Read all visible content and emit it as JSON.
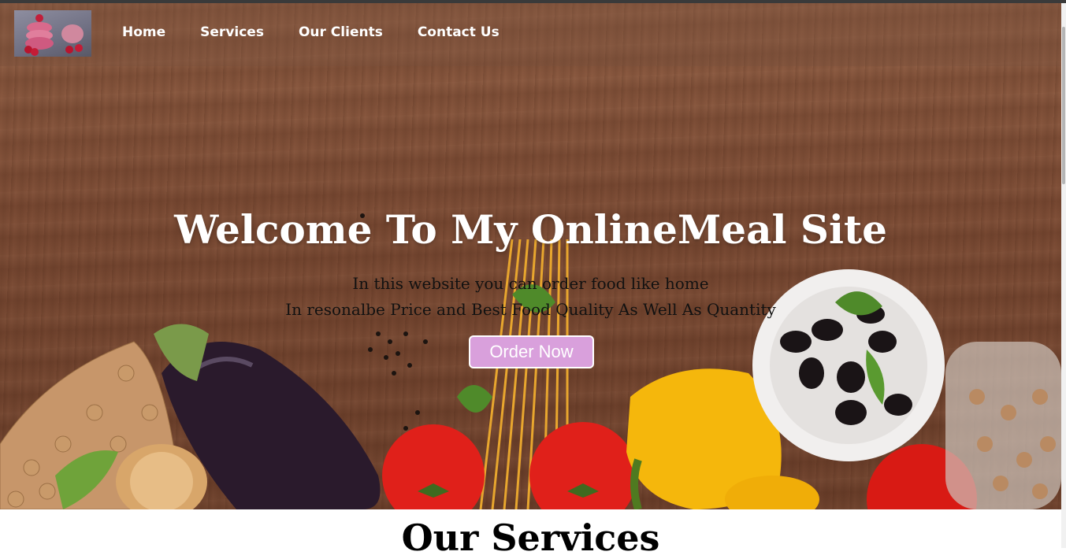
{
  "nav": {
    "logo_alt": "macarons logo",
    "links": [
      "Home",
      "Services",
      "Our Clients",
      "Contact Us"
    ]
  },
  "hero": {
    "title": "Welcome To My OnlineMeal Site",
    "subtitle_line1": "In this website you can order food like home",
    "subtitle_line2": "In resonalbe Price and Best Food Quality As Well As Quantity",
    "cta_label": "Order Now"
  },
  "services": {
    "heading": "Our Services"
  },
  "colors": {
    "cta_background": "#d9a0dc",
    "nav_text": "#ffffff",
    "wood_background": "#7b4a33"
  }
}
